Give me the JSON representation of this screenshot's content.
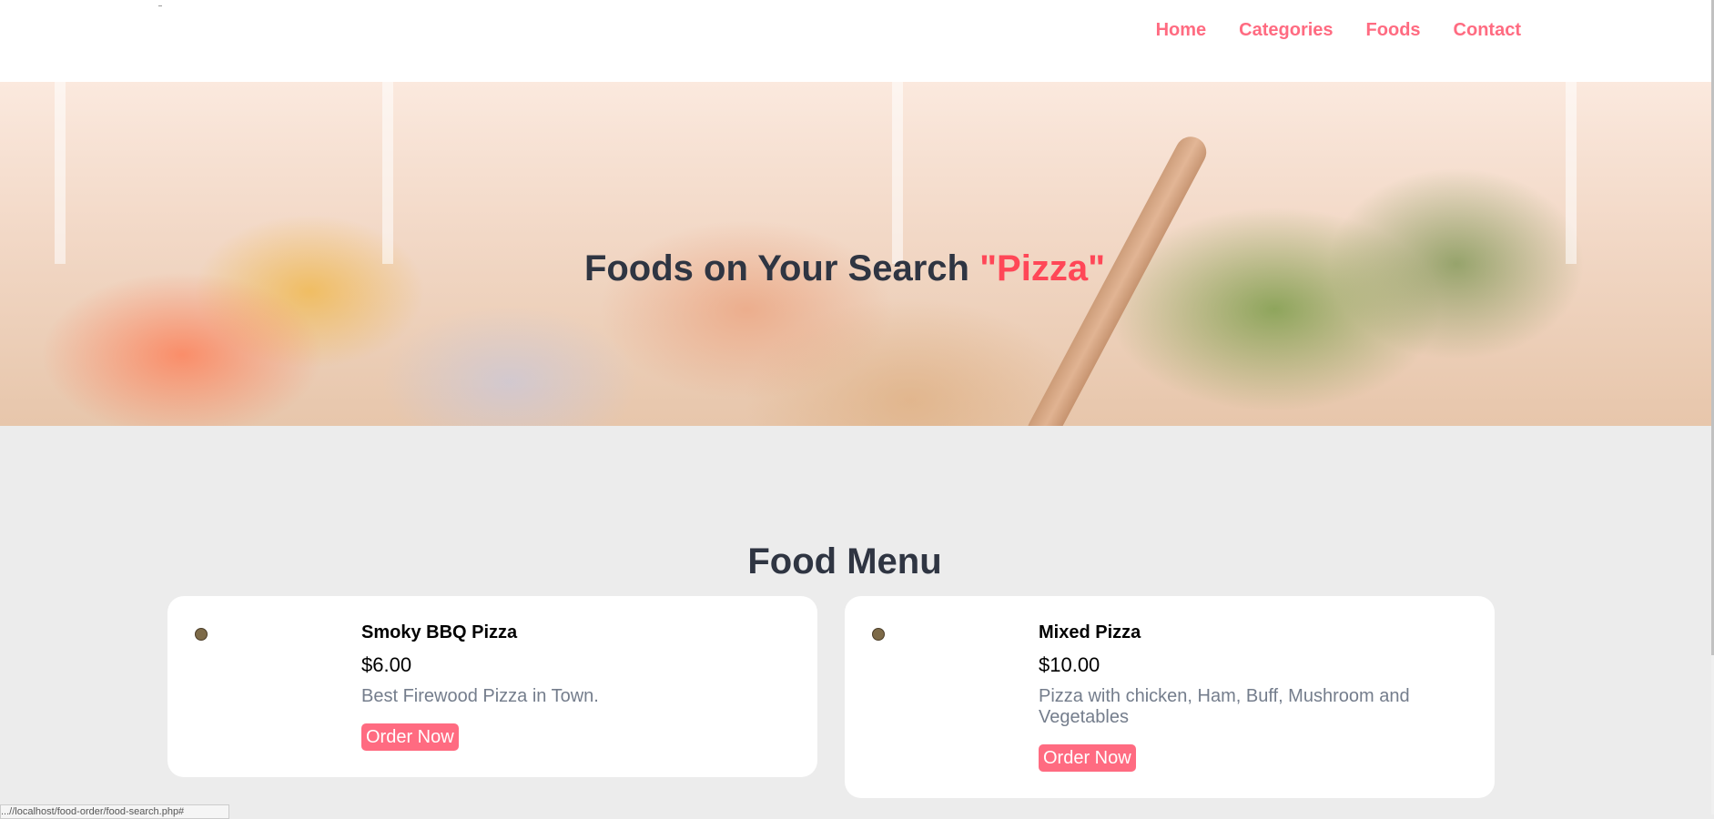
{
  "nav": {
    "links": [
      "Home",
      "Categories",
      "Foods",
      "Contact"
    ]
  },
  "hero": {
    "title_prefix": "Foods on Your Search ",
    "search_term": "\"Pizza\""
  },
  "menu": {
    "title": "Food Menu",
    "order_label": "Order Now",
    "items": [
      {
        "name": "Smoky BBQ Pizza",
        "price": "$6.00",
        "description": "Best Firewood Pizza in Town."
      },
      {
        "name": "Mixed Pizza",
        "price": "$10.00",
        "description": "Pizza with chicken, Ham, Buff, Mushroom and Vegetables"
      }
    ]
  },
  "status_bar": {
    "url": "...//localhost/food-order/food-search.php#"
  },
  "colors": {
    "accent": "#ff6b81",
    "highlight": "#ff4757",
    "heading": "#2f3542",
    "muted": "#747d8c",
    "page_bg": "#ececec"
  }
}
